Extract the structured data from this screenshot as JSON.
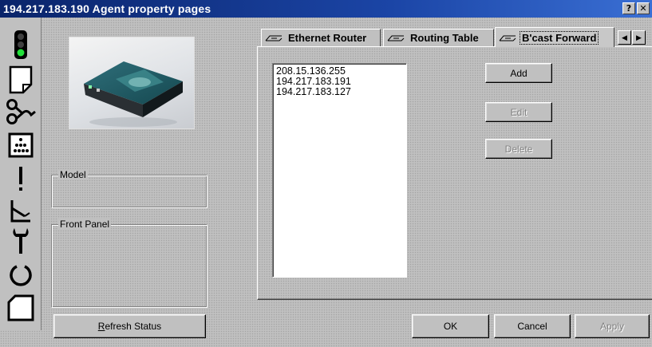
{
  "window": {
    "title": "194.217.183.190 Agent property pages",
    "help_glyph": "?",
    "close_glyph": "✕"
  },
  "toolbar": {
    "icons": [
      "traffic-light-icon",
      "page-icon",
      "route-icon",
      "dot-grid-icon",
      "exclamation-icon",
      "signal-icon",
      "wrench-icon",
      "cycle-icon",
      "card-icon"
    ]
  },
  "left_panel": {
    "model_label": "Model",
    "front_panel_label": "Front Panel",
    "refresh_label": "Refresh Status",
    "refresh_accel": "R",
    "refresh_rest": "efresh Status"
  },
  "tabs": [
    {
      "label": "Ethernet Router",
      "active": false
    },
    {
      "label": "Routing Table",
      "active": false
    },
    {
      "label": "B'cast Forward",
      "active": true
    }
  ],
  "tab_scroll": {
    "left": "◀",
    "right": "▶"
  },
  "bcast_forward": {
    "addresses": [
      "208.15.136.255",
      "194.217.183.191",
      "194.217.183.127"
    ],
    "add_label": "Add",
    "edit_label": "Edit",
    "delete_label": "Delete"
  },
  "dialog_buttons": {
    "ok_label": "OK",
    "cancel_label": "Cancel",
    "apply_label": "Apply"
  }
}
